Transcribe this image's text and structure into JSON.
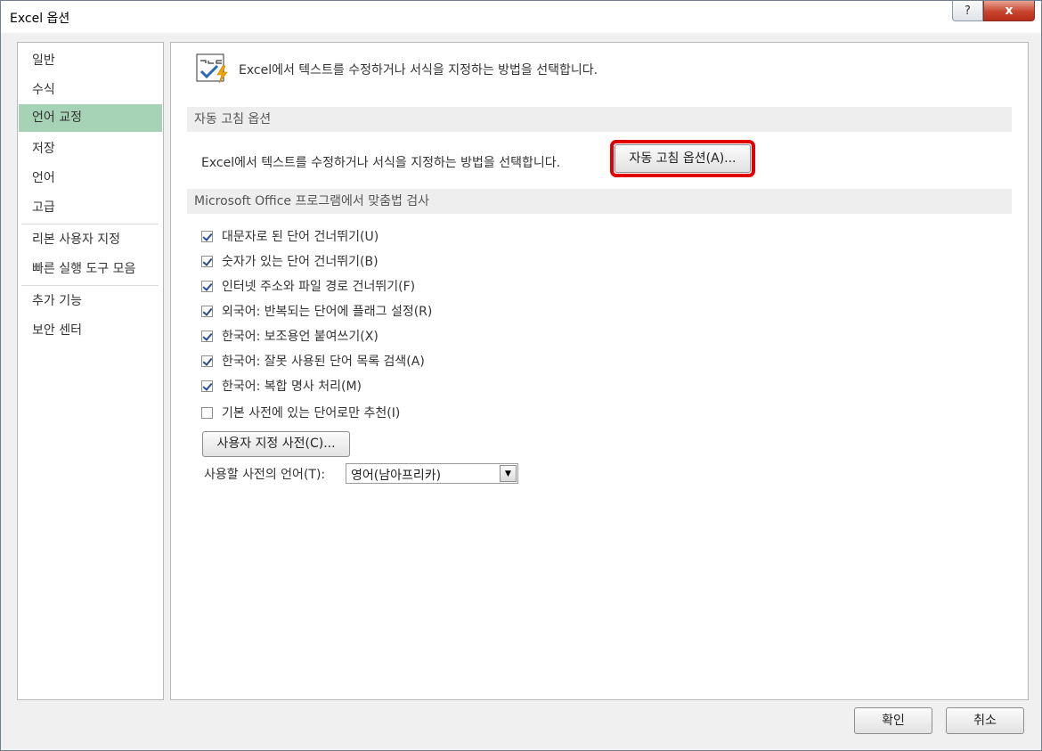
{
  "window": {
    "title": "Excel 옵션",
    "help_label": "?",
    "close_label": "x"
  },
  "nav": {
    "items": [
      {
        "label": "일반"
      },
      {
        "label": "수식"
      },
      {
        "label": "언어 교정",
        "selected": true
      },
      {
        "label": "저장"
      },
      {
        "label": "언어"
      },
      {
        "label": "고급"
      },
      {
        "label": "리본 사용자 지정"
      },
      {
        "label": "빠른 실행 도구 모음"
      },
      {
        "label": "추가 기능"
      },
      {
        "label": "보안 센터"
      }
    ]
  },
  "content": {
    "header_text": "Excel에서 텍스트를 수정하거나 서식을 지정하는 방법을 선택합니다.",
    "autocorrect": {
      "section_title": "자동 고침 옵션",
      "description": "Excel에서 텍스트를 수정하거나 서식을 지정하는 방법을 선택합니다.",
      "button_label": "자동 고침 옵션(A)..."
    },
    "spelling": {
      "section_title": "Microsoft Office 프로그램에서 맞춤법 검사",
      "checkboxes": [
        {
          "label": "대문자로 된 단어 건너뛰기(U)",
          "checked": true
        },
        {
          "label": "숫자가 있는 단어 건너뛰기(B)",
          "checked": true
        },
        {
          "label": "인터넷 주소와 파일 경로 건너뛰기(F)",
          "checked": true
        },
        {
          "label": "외국어: 반복되는 단어에 플래그 설정(R)",
          "checked": true
        },
        {
          "label": "한국어: 보조용언 붙여쓰기(X)",
          "checked": true
        },
        {
          "label": "한국어: 잘못 사용된 단어 목록 검색(A)",
          "checked": true
        },
        {
          "label": "한국어: 복합 명사 처리(M)",
          "checked": true
        },
        {
          "label": "기본 사전에 있는 단어로만 추천(I)",
          "checked": false
        }
      ],
      "custom_dict_button": "사용자 지정 사전(C)...",
      "dict_language_label": "사용할 사전의 언어(T):",
      "dict_language_value": "영어(남아프리카)"
    }
  },
  "footer": {
    "ok_label": "확인",
    "cancel_label": "취소"
  },
  "colors": {
    "selected_nav": "#a6d3b5",
    "highlight_border": "#e00000",
    "close_button": "#c7452f"
  },
  "icons": {
    "header_icon": "abc-check-icon",
    "dropdown": "chevron-down-icon"
  }
}
